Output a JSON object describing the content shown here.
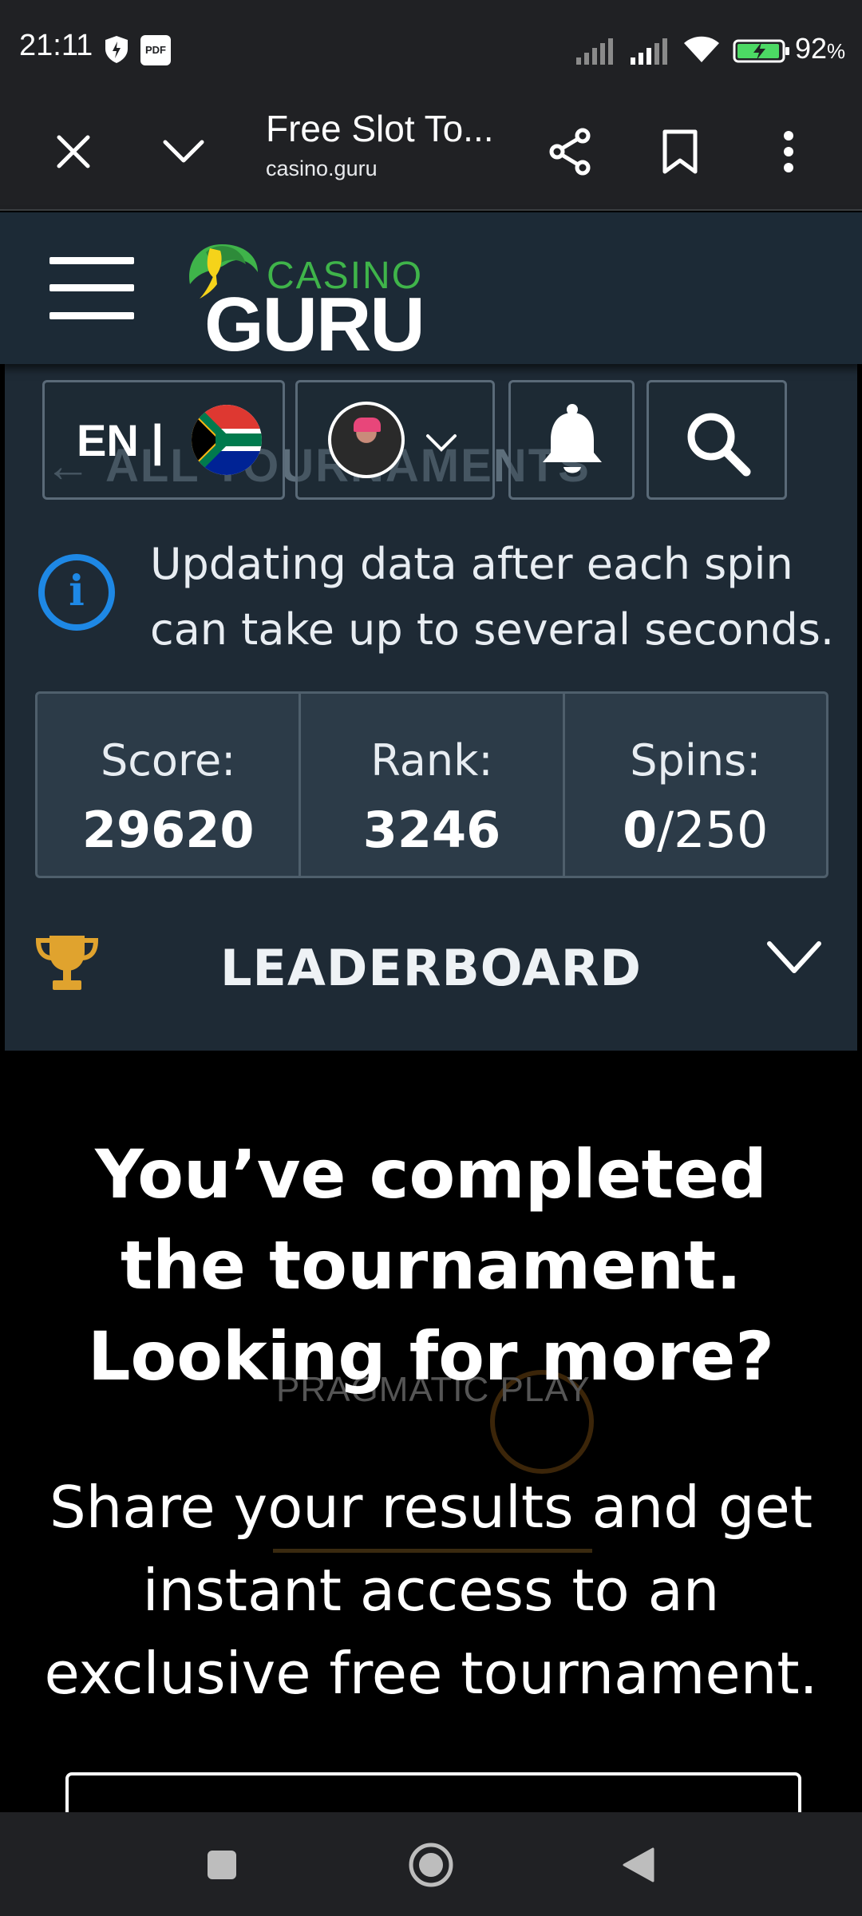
{
  "status_bar": {
    "time": "21:11",
    "pdf_label": "PDF",
    "battery_percent": "92",
    "battery_suffix": "%",
    "icons": [
      "shield-icon",
      "pdf-icon",
      "signal-icon",
      "signal-icon",
      "wifi-icon",
      "battery-charging-icon"
    ]
  },
  "browser": {
    "title": "Free Slot To...",
    "url": "casino.guru",
    "icons": [
      "close-icon",
      "chevron-down-icon",
      "share-icon",
      "bookmark-icon",
      "more-vert-icon"
    ]
  },
  "header": {
    "logo_small": "CASINO",
    "logo_big": "GURU",
    "brand_color": "#3fb44a"
  },
  "controls": {
    "back_link": "← ALL TOURNAMENTS",
    "language": "EN |",
    "icons": [
      "south-africa-flag-icon",
      "chevron-down-icon",
      "bell-icon",
      "search-icon"
    ]
  },
  "info": {
    "message": "Updating data after each spin can take up to several seconds.",
    "icon": "info-icon",
    "icon_color": "#1e88e5"
  },
  "stats": {
    "score_label": "Score:",
    "score_value": "29620",
    "rank_label": "Rank:",
    "rank_value": "3246",
    "spins_label": "Spins:",
    "spins_used": "0",
    "spins_total": "/250"
  },
  "leaderboard": {
    "title": "LEADERBOARD",
    "icons": [
      "trophy-icon",
      "chevron-down-icon"
    ],
    "trophy_color": "#e0a32e"
  },
  "promo": {
    "heading": "You’ve completed the tournament. Looking for more?",
    "text": "Share your results and get instant access to an exclusive free tournament.",
    "watermark": "PRAGMATIC PLAY"
  },
  "nav_bar": {
    "icons": [
      "recents-icon",
      "home-icon",
      "back-icon"
    ]
  }
}
